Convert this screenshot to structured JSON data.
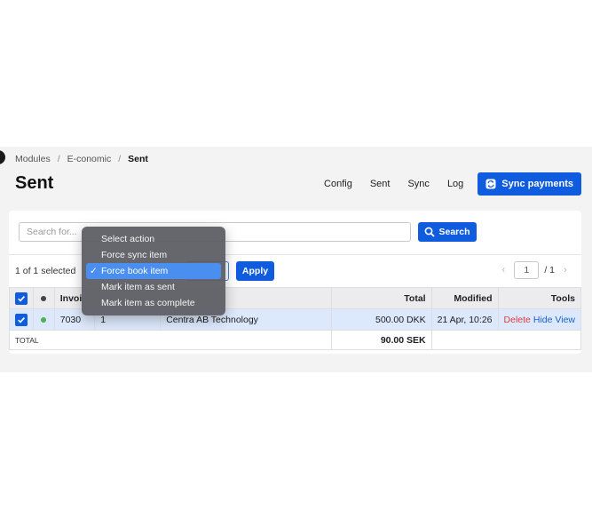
{
  "breadcrumb": {
    "modules": "Modules",
    "separator": "/",
    "economic": "E-conomic",
    "current": "Sent"
  },
  "page": {
    "title": "Sent"
  },
  "nav": {
    "config": "Config",
    "sent": "Sent",
    "sync": "Sync",
    "log": "Log",
    "sync_payments": "Sync payments"
  },
  "search": {
    "placeholder": "Search for...",
    "button": "Search"
  },
  "bulk": {
    "selected_count": "1 of 1 selected",
    "apply": "Apply"
  },
  "pager": {
    "prev": "‹",
    "page": "1",
    "of": "/ 1",
    "next": "›"
  },
  "table": {
    "headers": {
      "invoice": "Invoi",
      "total": "Total",
      "modified": "Modified",
      "tools": "Tools"
    },
    "rows": [
      {
        "invoice": "7030",
        "number": "1",
        "customer": "Centra AB Technology",
        "total": "500.00 DKK",
        "modified": "21 Apr, 10:26",
        "delete": "Delete",
        "hide": "Hide",
        "view": "View"
      }
    ],
    "footer": {
      "label": "TOTAL",
      "value": "90.00 SEK"
    }
  },
  "action_menu": {
    "items": [
      "Select action",
      "Force sync item",
      "Force book item",
      "Mark item as sent",
      "Mark item as complete"
    ],
    "selected": "Force book item",
    "check": "✓"
  },
  "colors": {
    "primary": "#0f5cde",
    "row_selected": "#dce8fb",
    "status_green": "#4caf50",
    "delete_red": "#e23b3b"
  }
}
